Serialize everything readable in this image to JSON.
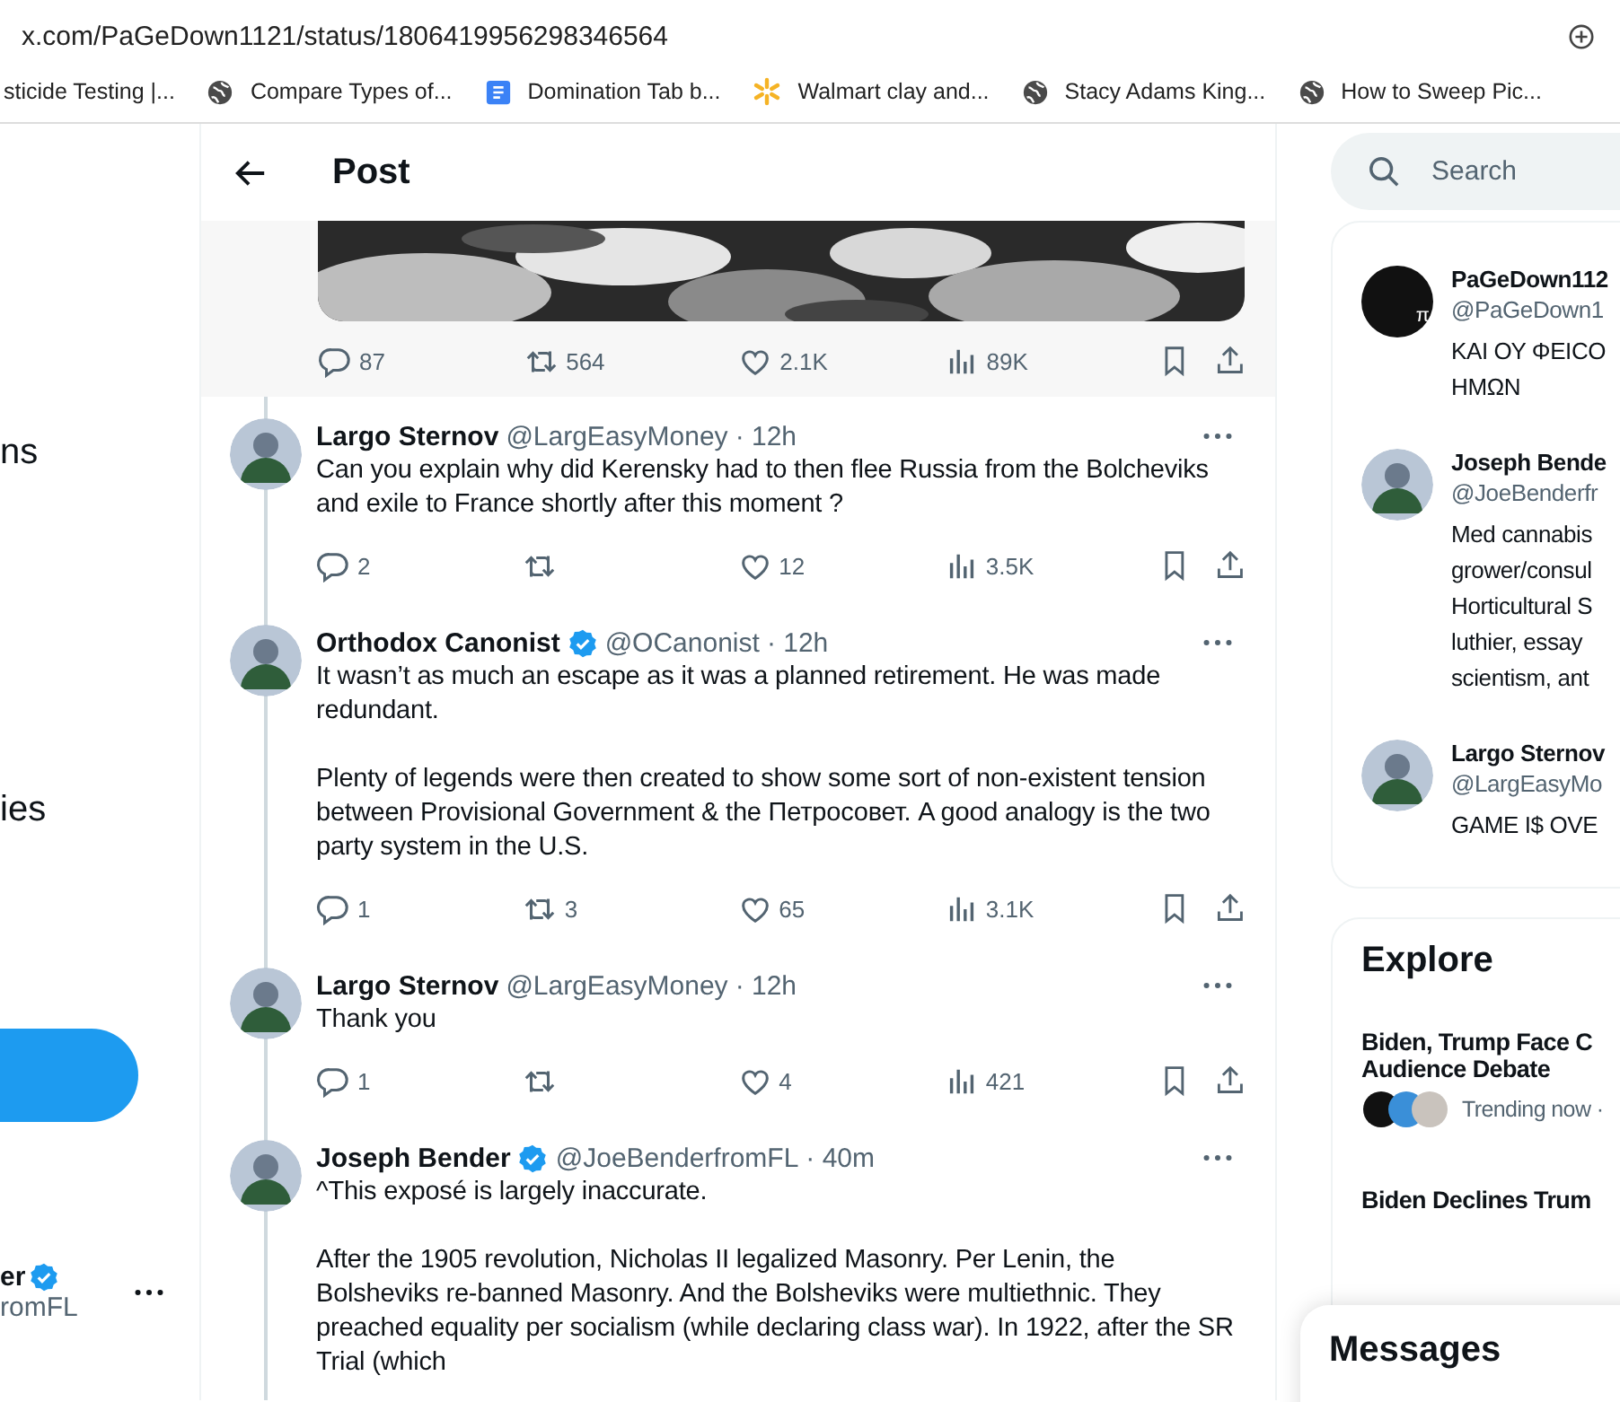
{
  "browser": {
    "url": "x.com/PaGeDown1121/status/1806419956298346564",
    "bookmarks": [
      {
        "label": "sticide Testing |...",
        "kind": "none"
      },
      {
        "label": "Compare Types of...",
        "kind": "globe"
      },
      {
        "label": "Domination Tab b...",
        "kind": "doc"
      },
      {
        "label": "Walmart clay and...",
        "kind": "spark"
      },
      {
        "label": "Stacy Adams King...",
        "kind": "globe"
      },
      {
        "label": "How to Sweep Pic...",
        "kind": "globe"
      }
    ]
  },
  "sidebar": {
    "items": [
      {
        "label": "ns"
      },
      {
        "label": "ies"
      }
    ],
    "account": {
      "name": "er",
      "verified": true,
      "handle": "romFL"
    }
  },
  "header": {
    "title": "Post"
  },
  "main_post": {
    "kind": "picture",
    "replies": "87",
    "reposts": "564",
    "likes": "2.1K",
    "views": "89K"
  },
  "replies": [
    {
      "name": "Largo Sternov",
      "verified": false,
      "handle": "@LargEasyMoney",
      "time": "· 12h",
      "paragraphs": [
        "Can you explain why did Kerensky had to then flee Russia from the Bolcheviks and exile to France shortly after this moment ?"
      ],
      "replies": "2",
      "likes": "12",
      "views": "3.5K"
    },
    {
      "name": "Orthodox Canonist",
      "verified": true,
      "handle": "@OCanonist",
      "time": "· 12h",
      "paragraphs": [
        "It wasn’t as much an escape as it was a planned retirement. He was made redundant.",
        "Plenty of legends were then created to show some sort of non-existent tension between Provisional Government & the Петросовет. A good analogy is the two party system in the U.S."
      ],
      "replies": "1",
      "reposts": "3",
      "likes": "65",
      "views": "3.1K"
    },
    {
      "name": "Largo Sternov",
      "verified": false,
      "handle": "@LargEasyMoney",
      "time": "· 12h",
      "paragraphs": [
        "Thank you"
      ],
      "replies": "1",
      "likes": "4",
      "views": "421"
    },
    {
      "name": "Joseph Bender",
      "verified": true,
      "handle": "@JoeBenderfromFL",
      "time": "· 40m",
      "paragraphs": [
        "^This exposé is largely inaccurate.",
        "After the 1905 revolution, Nicholas II legalized Masonry. Per Lenin, the Bolsheviks re-banned Masonry. And the Bolsheviks were multiethnic. They preached equality per socialism (while declaring class war). In 1922, after the SR Trial (which"
      ]
    }
  ],
  "search": {
    "placeholder": "Search"
  },
  "who_to_follow": [
    {
      "name": "PaGeDown112",
      "handle": "@PaGeDown1",
      "bio_lines": [
        "ΚΑΙ ΟΥ ΦΕΙCO",
        "ΗΜΩΝ"
      ],
      "avatar_text": "π"
    },
    {
      "name": "Joseph Bende",
      "handle": "@JoeBenderfr",
      "bio_lines": [
        "Med cannabis",
        "grower/consul",
        "Horticultural S",
        "luthier, essay",
        "scientism, ant"
      ]
    },
    {
      "name": "Largo Sternov",
      "handle": "@LargEasyMo",
      "bio_lines": [
        "GAME I$ OVE"
      ]
    }
  ],
  "explore": {
    "title": "Explore",
    "trends": [
      {
        "title_lines": [
          "Biden, Trump Face C",
          "Audience Debate"
        ],
        "meta": "Trending now ·"
      },
      {
        "title_lines": [
          "Biden Declines Trum"
        ]
      }
    ]
  },
  "messages": {
    "title": "Messages"
  }
}
